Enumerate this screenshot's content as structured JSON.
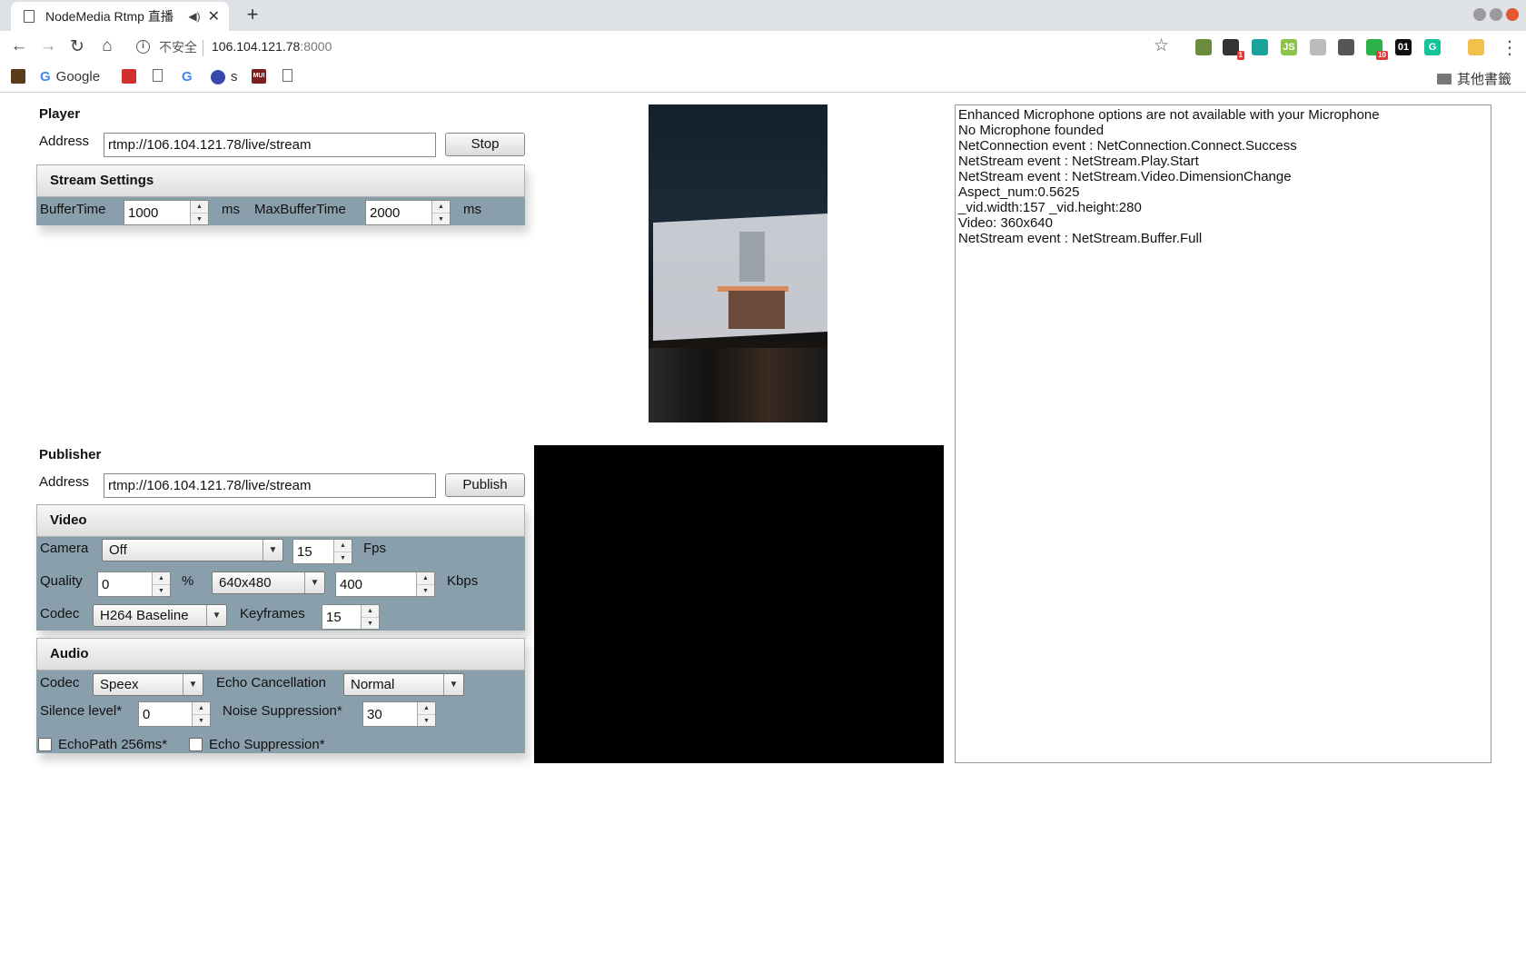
{
  "browser": {
    "tab_title": "NodeMedia Rtmp 直播",
    "new_tab": "+",
    "security_label": "不安全",
    "url_host": "106.104.121.78",
    "url_port": ":8000",
    "extensions": [
      {
        "icon": "evernote-ext-icon",
        "color": "#6d8b3e",
        "text": ""
      },
      {
        "icon": "chat-ext-icon",
        "color": "#333333",
        "text": "",
        "badge": "1"
      },
      {
        "icon": "eye-ext-icon",
        "color": "#1aa39a",
        "text": ""
      },
      {
        "icon": "js-ext-icon",
        "color": "#8bc34a",
        "text": "JS"
      },
      {
        "icon": "no-ads-ext-icon",
        "color": "#bbbbbb",
        "text": ""
      },
      {
        "icon": "pen-ext-icon",
        "color": "#555555",
        "text": ""
      },
      {
        "icon": "wechat-ext-icon",
        "color": "#2bb34a",
        "text": "",
        "badge": "10"
      },
      {
        "icon": "binary-ext-icon",
        "color": "#111111",
        "text": "01"
      },
      {
        "icon": "grammarly-ext-icon",
        "color": "#15c39a",
        "text": "G"
      },
      {
        "icon": "emoji-ext-icon",
        "color": "#f0c24b",
        "text": ""
      }
    ],
    "bookmarks": {
      "google": "Google",
      "s": "s",
      "other": "其他書籤"
    }
  },
  "player": {
    "title": "Player",
    "address_label": "Address",
    "address_value": "rtmp://106.104.121.78/live/stream",
    "stop_label": "Stop",
    "stream_settings": {
      "title": "Stream Settings",
      "buffer_label": "BufferTime",
      "buffer_value": "1000",
      "ms1": "ms",
      "max_label": "MaxBufferTime",
      "max_value": "2000",
      "ms2": "ms"
    }
  },
  "publisher": {
    "title": "Publisher",
    "address_label": "Address",
    "address_value": "rtmp://106.104.121.78/live/stream",
    "publish_label": "Publish",
    "video": {
      "title": "Video",
      "camera_label": "Camera",
      "camera_value": "Off",
      "fps_value": "15",
      "fps_label": "Fps",
      "quality_label": "Quality",
      "quality_value": "0",
      "percent": "%",
      "resolution_value": "640x480",
      "kbps_value": "400",
      "kbps_label": "Kbps",
      "codec_label": "Codec",
      "codec_value": "H264 Baseline",
      "keyframes_label": "Keyframes",
      "keyframes_value": "15"
    },
    "audio": {
      "title": "Audio",
      "codec_label": "Codec",
      "codec_value": "Speex",
      "echo_label": "Echo Cancellation",
      "echo_value": "Normal",
      "silence_label": "Silence level*",
      "silence_value": "0",
      "noise_label": "Noise Suppression*",
      "noise_value": "30",
      "echopath_label": "EchoPath 256ms*",
      "echosup_label": "Echo Suppression*"
    }
  },
  "log": [
    "Enhanced Microphone options are not available with your Microphone",
    "No Microphone founded",
    "NetConnection event : NetConnection.Connect.Success",
    "NetStream event : NetStream.Play.Start",
    "NetStream event : NetStream.Video.DimensionChange",
    "Aspect_num:0.5625",
    "_vid.width:157  _vid.height:280",
    "Video: 360x640",
    "NetStream event : NetStream.Buffer.Full"
  ]
}
